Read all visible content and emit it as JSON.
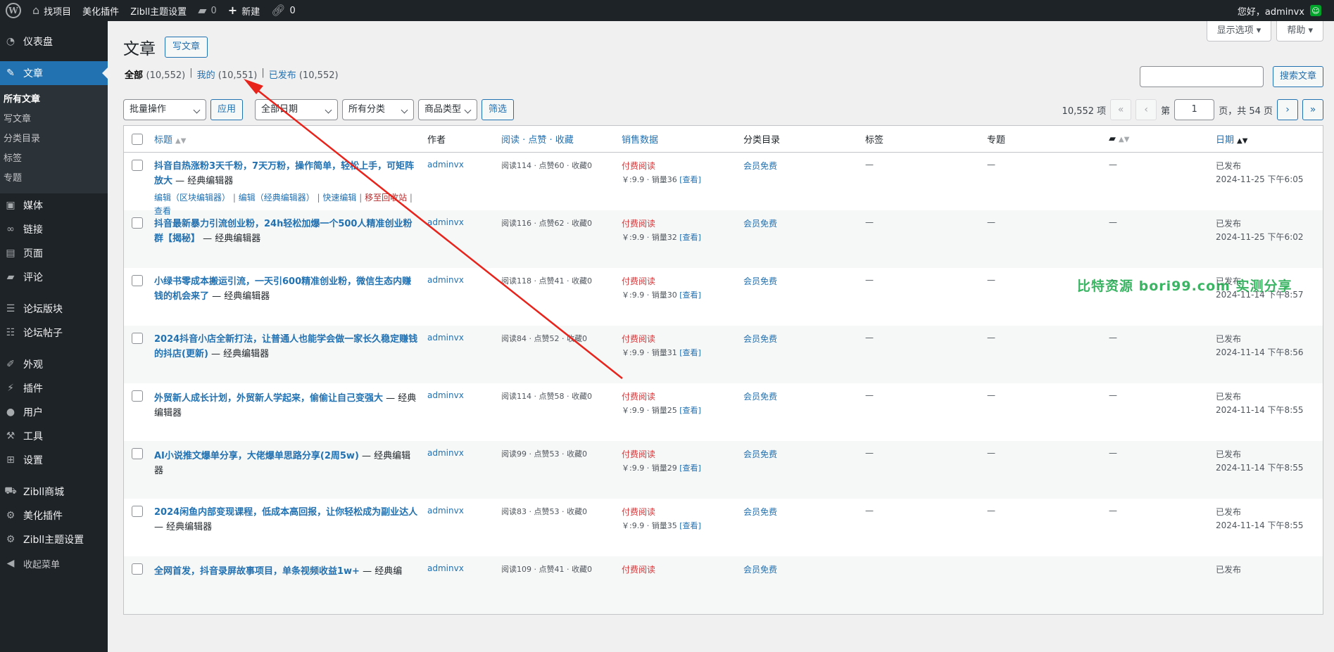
{
  "adminbar": {
    "site_name": "找项目",
    "menu1": "美化插件",
    "menu2": "Zibll主题设置",
    "comments": "0",
    "new_label": "新建",
    "links": "0",
    "greeting": "您好，adminvx"
  },
  "sidebar": {
    "dashboard": "仪表盘",
    "posts": "文章",
    "sub": [
      "所有文章",
      "写文章",
      "分类目录",
      "标签",
      "专题"
    ],
    "media": "媒体",
    "links": "链接",
    "pages": "页面",
    "comments": "评论",
    "forum_blocks": "论坛版块",
    "forum_posts": "论坛帖子",
    "appearance": "外观",
    "plugins": "插件",
    "users": "用户",
    "tools": "工具",
    "settings": "设置",
    "zibll_shop": "Zibll商城",
    "beautify": "美化插件",
    "zibll_settings": "Zibll主题设置",
    "collapse": "收起菜单"
  },
  "screen_options": "显示选项 ▾",
  "help": "帮助 ▾",
  "page": {
    "title": "文章",
    "add_new": "写文章"
  },
  "views": {
    "all": "全部",
    "all_count": "(10,552)",
    "mine": "我的",
    "mine_count": "(10,551)",
    "published": "已发布",
    "published_count": "(10,552)"
  },
  "search": {
    "button": "搜索文章"
  },
  "tablenav": {
    "bulk": "批量操作",
    "apply": "应用",
    "dates": "全部日期",
    "cats": "所有分类",
    "product_type": "商品类型",
    "filter": "筛选",
    "items": "10,552 项",
    "first": "«",
    "prev": "‹",
    "page_prefix": "第",
    "current_page": "1",
    "page_suffix": "页，共 54 页",
    "next": "›",
    "last": "»"
  },
  "columns": {
    "title": "标题",
    "author": "作者",
    "reads": "阅读 · 点赞 · 收藏",
    "sales": "销售数据",
    "category": "分类目录",
    "tags": "标签",
    "topic": "专题",
    "date": "日期"
  },
  "row_actions": {
    "edit_block": "编辑（区块编辑器）",
    "edit_classic": "编辑（经典编辑器）",
    "quick_edit": "快速编辑",
    "trash": "移至回收站",
    "view": "查看"
  },
  "posts": [
    {
      "title": "抖音自热涨粉3天千粉，7天万粉，操作简单，轻松上手，可矩阵放大",
      "state": " — 经典编辑器",
      "author": "adminvx",
      "reads": "阅读114 · 点赞60 · 收藏0",
      "paid": "付费阅读",
      "price": "￥:9.9 · 销量36",
      "view": "[查看]",
      "category": "会员免费",
      "tags": "—",
      "topic": "—",
      "comments": "—",
      "status": "已发布",
      "date": "2024-11-25 下午6:05"
    },
    {
      "title": "抖音最新暴力引流创业粉，24h轻松加爆一个500人精准创业粉群【揭秘】",
      "state": " — 经典编辑器",
      "author": "adminvx",
      "reads": "阅读116 · 点赞62 · 收藏0",
      "paid": "付费阅读",
      "price": "￥:9.9 · 销量32",
      "view": "[查看]",
      "category": "会员免费",
      "tags": "—",
      "topic": "—",
      "comments": "—",
      "status": "已发布",
      "date": "2024-11-25 下午6:02"
    },
    {
      "title": "小绿书零成本搬运引流，一天引600精准创业粉，微信生态内赚钱的机会来了",
      "state": " — 经典编辑器",
      "author": "adminvx",
      "reads": "阅读118 · 点赞41 · 收藏0",
      "paid": "付费阅读",
      "price": "￥:9.9 · 销量30",
      "view": "[查看]",
      "category": "会员免费",
      "tags": "—",
      "topic": "—",
      "comments": "—",
      "status": "已发布",
      "date": "2024-11-14 下午8:57"
    },
    {
      "title": "2024抖音小店全新打法，让普通人也能学会做一家长久稳定赚钱的抖店(更新)",
      "state": " — 经典编辑器",
      "author": "adminvx",
      "reads": "阅读84 · 点赞52 · 收藏0",
      "paid": "付费阅读",
      "price": "￥:9.9 · 销量31",
      "view": "[查看]",
      "category": "会员免费",
      "tags": "—",
      "topic": "—",
      "comments": "—",
      "status": "已发布",
      "date": "2024-11-14 下午8:56"
    },
    {
      "title": "外贸新人成长计划，外贸新人学起来，偷偷让自己变强大",
      "state": " — 经典编辑器",
      "author": "adminvx",
      "reads": "阅读114 · 点赞58 · 收藏0",
      "paid": "付费阅读",
      "price": "￥:9.9 · 销量25",
      "view": "[查看]",
      "category": "会员免费",
      "tags": "—",
      "topic": "—",
      "comments": "—",
      "status": "已发布",
      "date": "2024-11-14 下午8:55"
    },
    {
      "title": "AI小说推文爆单分享，大佬爆单思路分享(2周5w)",
      "state": " — 经典编辑器",
      "author": "adminvx",
      "reads": "阅读99 · 点赞53 · 收藏0",
      "paid": "付费阅读",
      "price": "￥:9.9 · 销量29",
      "view": "[查看]",
      "category": "会员免费",
      "tags": "—",
      "topic": "—",
      "comments": "—",
      "status": "已发布",
      "date": "2024-11-14 下午8:55"
    },
    {
      "title": "2024闲鱼内部变现课程，低成本高回报，让你轻松成为副业达人",
      "state": " — 经典编辑器",
      "author": "adminvx",
      "reads": "阅读83 · 点赞53 · 收藏0",
      "paid": "付费阅读",
      "price": "￥:9.9 · 销量35",
      "view": "[查看]",
      "category": "会员免费",
      "tags": "—",
      "topic": "—",
      "comments": "—",
      "status": "已发布",
      "date": "2024-11-14 下午8:55"
    },
    {
      "title": "全网首发，抖音录屏故事项目，单条视频收益1w+",
      "state": " — 经典编",
      "author": "adminvx",
      "reads": "阅读109 · 点赞41 · 收藏0",
      "paid": "付费阅读",
      "price": "",
      "view": "",
      "category": "会员免费",
      "tags": "",
      "topic": "",
      "comments": "",
      "status": "已发布",
      "date": ""
    }
  ],
  "watermark": "比特资源 bori99.com 实测分享"
}
